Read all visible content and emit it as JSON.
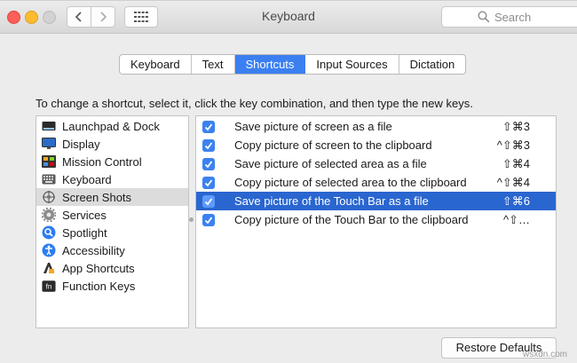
{
  "window": {
    "title": "Keyboard",
    "search_placeholder": "Search"
  },
  "tabs": [
    {
      "label": "Keyboard",
      "active": false
    },
    {
      "label": "Text",
      "active": false
    },
    {
      "label": "Shortcuts",
      "active": true
    },
    {
      "label": "Input Sources",
      "active": false
    },
    {
      "label": "Dictation",
      "active": false
    }
  ],
  "instructions": "To change a shortcut, select it, click the key combination, and then type the new keys.",
  "categories": [
    {
      "label": "Launchpad & Dock",
      "icon": "launchpad-dock-icon"
    },
    {
      "label": "Display",
      "icon": "display-icon"
    },
    {
      "label": "Mission Control",
      "icon": "mission-control-icon"
    },
    {
      "label": "Keyboard",
      "icon": "keyboard-icon"
    },
    {
      "label": "Screen Shots",
      "icon": "screenshot-icon",
      "selected": true
    },
    {
      "label": "Services",
      "icon": "gear-icon"
    },
    {
      "label": "Spotlight",
      "icon": "spotlight-icon"
    },
    {
      "label": "Accessibility",
      "icon": "accessibility-icon"
    },
    {
      "label": "App Shortcuts",
      "icon": "app-shortcuts-icon"
    },
    {
      "label": "Function Keys",
      "icon": "fn-key-icon",
      "icon_text": "fn"
    }
  ],
  "shortcuts": [
    {
      "label": "Save picture of screen as a file",
      "keys": "⇧⌘3",
      "checked": true
    },
    {
      "label": "Copy picture of screen to the clipboard",
      "keys": "^⇧⌘3",
      "checked": true
    },
    {
      "label": "Save picture of selected area as a file",
      "keys": "⇧⌘4",
      "checked": true
    },
    {
      "label": "Copy picture of selected area to the clipboard",
      "keys": "^⇧⌘4",
      "checked": true
    },
    {
      "label": "Save picture of the Touch Bar as a file",
      "keys": "⇧⌘6",
      "checked": true,
      "selected": true
    },
    {
      "label": "Copy picture of the Touch Bar to the clipboard",
      "keys": "^⇧…",
      "checked": true
    }
  ],
  "restore_label": "Restore Defaults",
  "watermark": "wsxdn.com",
  "colors": {
    "accent": "#3b7ff1",
    "selection": "#2a66d0",
    "checkbox": "#3b82f0"
  }
}
